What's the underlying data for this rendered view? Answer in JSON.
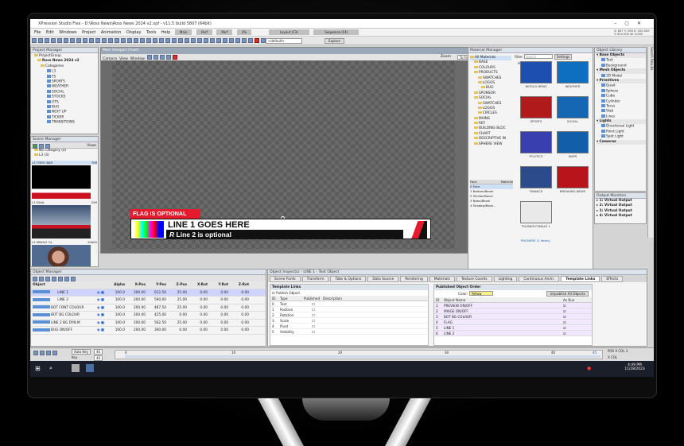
{
  "window": {
    "title": "XPression Studio Flex - D:\\Ross News\\Ross News 2024 v2.xpf - v11.5 build 5807 (64bit)",
    "coords": "X: 847   Y: 208   X: 200.000   Y: 610.000   W: 0.000"
  },
  "menu": [
    "File",
    "Edit",
    "Windows",
    "Project",
    "Animation",
    "Display",
    "Tools",
    "Help"
  ],
  "modes": [
    "Main",
    "Perf",
    "Perf",
    "2%",
    "Layout (F3)",
    "Sequence (F4)"
  ],
  "toolbar": {
    "dropdown": "<default>",
    "explore": "Explore"
  },
  "project_manager": {
    "title": "Project Manager",
    "items": [
      "ProjectGroup",
      "Ross News 2024 v2",
      "Categories",
      "L3",
      "FS",
      "SPORTS",
      "WEATHER",
      "SOCIAL",
      "STOCKS",
      "OTS",
      "BUG",
      "NEXT UP",
      "TICKER",
      "TRANSITIONS"
    ]
  },
  "scene_manager": {
    "title": "Scene Manager",
    "view": "Views",
    "items": [
      "No Category (0)",
      "L3 (3)"
    ],
    "scenes": [
      {
        "name": "L3 TOPIC BAR",
        "num": "708"
      },
      {
        "name": "L3 DUAL",
        "num": "299"
      },
      {
        "name": "L3 SINGLE OL",
        "num": "10000"
      }
    ]
  },
  "viewport": {
    "title": "Main Viewport (Frost)",
    "menu": [
      "Camera",
      "View",
      "Window"
    ],
    "zoom_label": "Zoom",
    "zoom": "To Fit"
  },
  "lower_third": {
    "flag": "FLAG IS OPTIONAL",
    "line1": "LINE 1 GOES HERE",
    "line2": "Line 2 is optional"
  },
  "material_manager": {
    "title": "Material Manager",
    "filter": "Filter:",
    "search": "Search",
    "settings": "Settings",
    "tree": [
      "All Materials",
      "BASE",
      "COLOURS",
      "PRODUCTS",
      "SWATCHES",
      "LOGOS",
      "BUG",
      "SPONSOR",
      "SOCIAL",
      "SWATCHES",
      "LOGOS",
      "CIRCLES",
      "MAINS",
      "REF",
      "BUILDING BLOC",
      "CHART",
      "DESCRIPTIVE IN",
      "SPHERE VIEW"
    ],
    "face_header": [
      "Face",
      "Material"
    ],
    "faces": [
      "Face",
      "Bottom/Bevel",
      "Similar/Bevel",
      "Neon/Bevel",
      "Shadow/Back..."
    ],
    "selected": "Selected Objects: 1",
    "tab1": "PHONE",
    "tab2": "TEMPLAT...",
    "group": "TOPICS (8 items)",
    "group2": "PHONERS (1 items)"
  },
  "thumbnails": [
    {
      "label": "WORLD NEWS",
      "bg": "#1d4fb0"
    },
    {
      "label": "WEATHER",
      "bg": "#0e6fc0"
    },
    {
      "label": "SPORTS",
      "bg": "#b01a1a"
    },
    {
      "label": "SOCIAL",
      "bg": "#1566b3"
    },
    {
      "label": "POLITICS",
      "bg": "#3a3fb0"
    },
    {
      "label": "MAPS",
      "bg": "#125ea8"
    },
    {
      "label": "FINANCE",
      "bg": "#2b4b8a"
    },
    {
      "label": "BREAKING NEWS",
      "bg": "#b8141b"
    },
    {
      "label": "PHONER FEMALE 1",
      "bg": "#e9e9e9"
    }
  ],
  "object_library": {
    "title": "Object Library",
    "sections": [
      {
        "name": "Base Objects",
        "items": [
          "Text",
          "Background"
        ]
      },
      {
        "name": "Mesh Objects",
        "items": [
          "3D Model"
        ]
      },
      {
        "name": "Primitives",
        "items": [
          "Quad",
          "Sphere",
          "Cube",
          "Cylinder",
          "Torus",
          "Slab",
          "Lines"
        ]
      },
      {
        "name": "Lights",
        "items": [
          "Directional Light",
          "Point Light",
          "Spot Light"
        ]
      },
      {
        "name": "Cameras",
        "items": []
      }
    ]
  },
  "output_monitors": {
    "title": "Output Monitors",
    "items": [
      "1: Virtual Output",
      "2: Virtual Output",
      "3: Virtual Output",
      "4: Virtual Output"
    ]
  },
  "side_tabs": [
    "Font Manager",
    "Widget Animations",
    "Animation Controller",
    "Effects",
    "Audio Files",
    "Scene Directors",
    "Search Results"
  ],
  "object_manager": {
    "title": "Object Manager",
    "columns": [
      "Object",
      "Alpha",
      "X-Pos",
      "Y-Pos",
      "Z-Pos",
      "X-Rot",
      "Y-Rot",
      "Z-Rot"
    ],
    "rows": [
      [
        "LINE 1",
        "100.0",
        "200.00",
        "612.50",
        "25.00",
        "0.00",
        "0.00",
        "0.00"
      ],
      [
        "LINE 2",
        "100.0",
        "200.00",
        "590.00",
        "25.00",
        "0.00",
        "0.00",
        "0.00"
      ],
      [
        "BOT FONT COLOUR",
        "100.0",
        "200.00",
        "487.50",
        "25.00",
        "0.00",
        "0.00",
        "0.00"
      ],
      [
        "BOT BG COLOUR",
        "100.0",
        "200.00",
        "425.00",
        "0.00",
        "0.00",
        "0.00",
        "0.00"
      ],
      [
        "LINE 2 BG DYN.M",
        "100.0",
        "200.00",
        "562.50",
        "25.00",
        "0.00",
        "0.00",
        "0.00"
      ],
      [
        "BUG ON/OFF",
        "100.0",
        "200.00",
        "300.00",
        "0.00",
        "0.00",
        "0.00",
        "0.00"
      ]
    ]
  },
  "object_inspector": {
    "title": "Object Inspector - LINE 1 - Text Object",
    "tabs": [
      "Scene Fonts",
      "Transform",
      "Tabs & Options",
      "Data Source",
      "Rendering",
      "Materials",
      "Texture Coords",
      "Lighting",
      "Continuous Anim.",
      "Template Links",
      "Effects"
    ],
    "left_title": "Template Links",
    "publish": "Publish Object",
    "cols": [
      "ID",
      "Type",
      "Published",
      "Description"
    ],
    "rows": [
      [
        "0",
        "Text"
      ],
      [
        "1",
        "Position"
      ],
      [
        "2",
        "Rotation"
      ],
      [
        "3",
        "Scale"
      ],
      [
        "4",
        "Pivot"
      ],
      [
        "5",
        "Visibility"
      ]
    ],
    "right_title": "Published Object Order",
    "color_label": "Color:",
    "color_value": "Yellow",
    "unpublish": "Unpublish All Objects",
    "rcols": [
      "ID",
      "Object Name",
      "As Run"
    ],
    "rrows": [
      [
        "1",
        "PREVIEW ON/OFF"
      ],
      [
        "2",
        "IMAGE ON/OFF"
      ],
      [
        "3",
        "BOT BG COLOUR"
      ],
      [
        "4",
        "FLAG"
      ],
      [
        "5",
        "LINE 1"
      ],
      [
        "6",
        "LINE 2"
      ]
    ]
  },
  "timeline": {
    "autokey": "Auto Key",
    "key": "Key",
    "frame": "46",
    "frame2": "46",
    "marks": [
      "0",
      "10",
      "20",
      "30",
      "40",
      "45"
    ],
    "pos": "POS X COL 3",
    "xcol": "X COL"
  },
  "taskbar": {
    "time": "4:49 PM",
    "date": "11/28/2023"
  }
}
